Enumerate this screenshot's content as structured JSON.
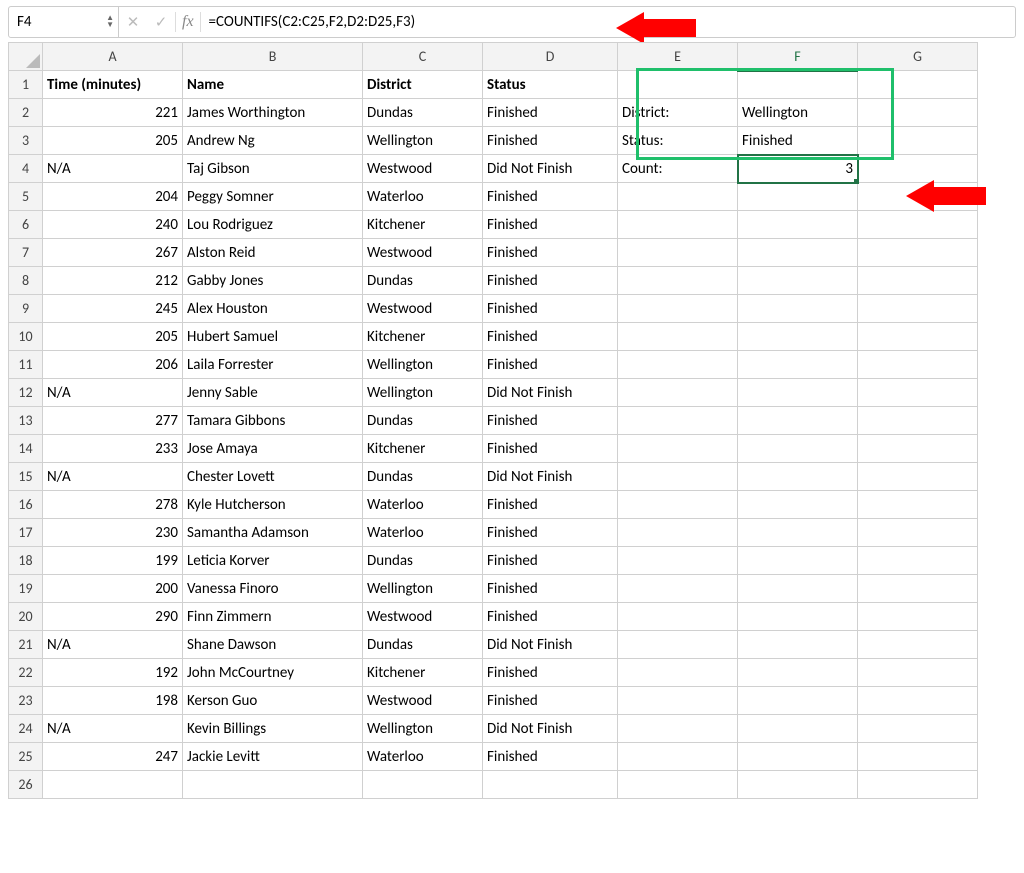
{
  "formula_bar": {
    "name_box": "F4",
    "fx_label": "fx",
    "formula": "=COUNTIFS(C2:C25,F2,D2:D25,F3)"
  },
  "columns": [
    "A",
    "B",
    "C",
    "D",
    "E",
    "F",
    "G"
  ],
  "row_numbers": [
    "1",
    "2",
    "3",
    "4",
    "5",
    "6",
    "7",
    "8",
    "9",
    "10",
    "11",
    "12",
    "13",
    "14",
    "15",
    "16",
    "17",
    "18",
    "19",
    "20",
    "21",
    "22",
    "23",
    "24",
    "25",
    "26"
  ],
  "headers": {
    "time": "Time (minutes)",
    "name": "Name",
    "district": "District",
    "status": "Status"
  },
  "criteria": {
    "district_label": "District:",
    "district_value": "Wellington",
    "status_label": "Status:",
    "status_value": "Finished",
    "count_label": "Count:",
    "count_value": "3"
  },
  "rows": [
    {
      "time": "221",
      "name": "James Worthington",
      "district": "Dundas",
      "status": "Finished"
    },
    {
      "time": "205",
      "name": "Andrew Ng",
      "district": "Wellington",
      "status": "Finished"
    },
    {
      "time": "N/A",
      "name": "Taj Gibson",
      "district": "Westwood",
      "status": "Did Not Finish"
    },
    {
      "time": "204",
      "name": "Peggy Somner",
      "district": "Waterloo",
      "status": "Finished"
    },
    {
      "time": "240",
      "name": "Lou Rodriguez",
      "district": "Kitchener",
      "status": "Finished"
    },
    {
      "time": "267",
      "name": "Alston Reid",
      "district": "Westwood",
      "status": "Finished"
    },
    {
      "time": "212",
      "name": "Gabby Jones",
      "district": "Dundas",
      "status": "Finished"
    },
    {
      "time": "245",
      "name": "Alex Houston",
      "district": "Westwood",
      "status": "Finished"
    },
    {
      "time": "205",
      "name": "Hubert Samuel",
      "district": "Kitchener",
      "status": "Finished"
    },
    {
      "time": "206",
      "name": "Laila Forrester",
      "district": "Wellington",
      "status": "Finished"
    },
    {
      "time": "N/A",
      "name": "Jenny Sable",
      "district": "Wellington",
      "status": "Did Not Finish"
    },
    {
      "time": "277",
      "name": "Tamara Gibbons",
      "district": "Dundas",
      "status": "Finished"
    },
    {
      "time": "233",
      "name": "Jose Amaya",
      "district": "Kitchener",
      "status": "Finished"
    },
    {
      "time": "N/A",
      "name": "Chester Lovett",
      "district": "Dundas",
      "status": "Did Not Finish"
    },
    {
      "time": "278",
      "name": "Kyle Hutcherson",
      "district": "Waterloo",
      "status": "Finished"
    },
    {
      "time": "230",
      "name": "Samantha Adamson",
      "district": "Waterloo",
      "status": "Finished"
    },
    {
      "time": "199",
      "name": "Leticia Korver",
      "district": "Dundas",
      "status": "Finished"
    },
    {
      "time": "200",
      "name": "Vanessa Finoro",
      "district": "Wellington",
      "status": "Finished"
    },
    {
      "time": "290",
      "name": "Finn Zimmern",
      "district": "Westwood",
      "status": "Finished"
    },
    {
      "time": "N/A",
      "name": "Shane Dawson",
      "district": "Dundas",
      "status": "Did Not Finish"
    },
    {
      "time": "192",
      "name": "John McCourtney",
      "district": "Kitchener",
      "status": "Finished"
    },
    {
      "time": "198",
      "name": "Kerson Guo",
      "district": "Westwood",
      "status": "Finished"
    },
    {
      "time": "N/A",
      "name": "Kevin Billings",
      "district": "Wellington",
      "status": "Did Not Finish"
    },
    {
      "time": "247",
      "name": "Jackie Levitt",
      "district": "Waterloo",
      "status": "Finished"
    }
  ]
}
